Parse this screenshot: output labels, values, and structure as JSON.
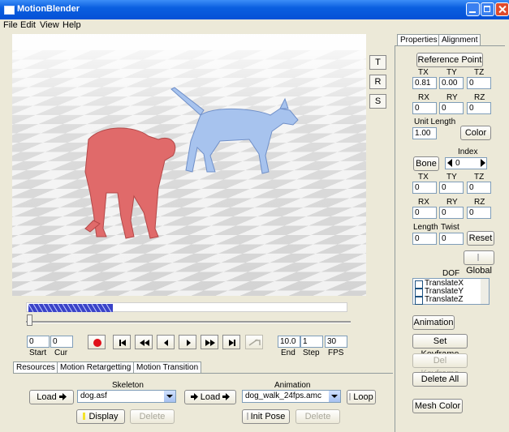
{
  "window": {
    "title": "MotionBlender"
  },
  "menu": [
    "File",
    "Edit",
    "View",
    "Help"
  ],
  "viewport_buttons": [
    "T",
    "R",
    "S"
  ],
  "properties": {
    "tabs": [
      "Properties",
      "Alignment"
    ],
    "reference_point_label": "Reference Point",
    "tx_label": "TX",
    "ty_label": "TY",
    "tz_label": "TZ",
    "rx_label": "RX",
    "ry_label": "RY",
    "rz_label": "RZ",
    "tx": "0.81",
    "ty": "0.00",
    "tz": "0",
    "rx": "0",
    "ry": "0",
    "rz": "0",
    "unit_length_label": "Unit Length",
    "unit_length": "1.00",
    "color_button": "Color",
    "index_label": "Index",
    "bone_button": "Bone",
    "index_value": "0",
    "bone_tx": "0",
    "bone_ty": "0",
    "bone_tz": "0",
    "bone_rx": "0",
    "bone_ry": "0",
    "bone_rz": "0",
    "length_label": "Length",
    "twist_label": "Twist",
    "length_value": "0",
    "twist_value": "0",
    "reset_button": "Reset",
    "global_button": "Global",
    "dof_label": "DOF",
    "dof_items": [
      "TranslateX",
      "TranslateY",
      "TranslateZ"
    ],
    "animation_button": "Animation",
    "set_keyframe_button": "Set Keyframe",
    "del_keyframe_button": "Del Keyframe",
    "delete_all_button": "Delete All",
    "mesh_color_button": "Mesh Color"
  },
  "timeline": {
    "start_value": "0",
    "cur_value": "0",
    "start_label": "Start",
    "cur_label": "Cur",
    "end_value": "10.0",
    "step_value": "1",
    "fps_value": "30",
    "end_label": "End",
    "step_label": "Step",
    "fps_label": "FPS",
    "record_color": "#e0101a"
  },
  "bottom": {
    "tabs": [
      "Resources",
      "Motion Retargetting",
      "Motion Transition"
    ],
    "skeleton_label": "Skeleton",
    "animation_label": "Animation",
    "load_label": "Load",
    "skeleton_file": "dog.asf",
    "animation_file": "dog_walk_24fps.amc",
    "loop_label": "Loop",
    "display_label": "Display",
    "delete_label": "Delete",
    "init_pose_label": "Init Pose",
    "display_indicator_color": "#f3e32a"
  },
  "colors": {
    "titlebar": "#0a5fe0",
    "human_figure": "#e06a6a",
    "dog_figure": "#a7c3ee"
  }
}
